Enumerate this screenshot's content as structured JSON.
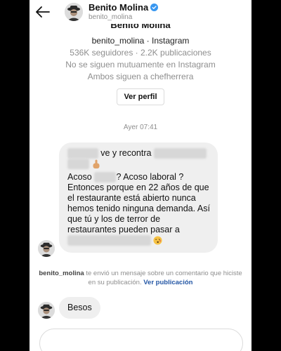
{
  "header": {
    "name": "Benito Molina",
    "username": "benito_molina",
    "back_icon": "arrow-left-icon",
    "verified_icon": "verified-badge-icon"
  },
  "profile": {
    "name": "Benito Molina",
    "username_platform": "benito_molina · Instagram",
    "stats": "536K seguidores · 2.2K publicaciones",
    "mutual": "No se siguen mutuamente en Instagram",
    "followed_by": "Ambos siguen a chefherrera",
    "view_profile_label": "Ver perfil"
  },
  "timestamp": "Ayer 07:41",
  "message1": {
    "line1_text": " ve y recontra ",
    "line2_start": "Acoso ",
    "line2_end": "? Acoso laboral ?",
    "body": "Entonces porque en 22 años de que el restaurante está abierto nunca hemos tenido ninguna demanda. Así que tú y los de terror de restaurantes pueden pasar a"
  },
  "notice": {
    "user": "benito_molina",
    "text": " te envió un mensaje sobre un comentario que hiciste en su publicación. ",
    "link": "Ver publicación"
  },
  "message2": {
    "text": "Besos"
  },
  "colors": {
    "bubble": "#efefef",
    "link": "#2457a5",
    "verified": "#3897f0",
    "muted": "#8e8e8e"
  }
}
